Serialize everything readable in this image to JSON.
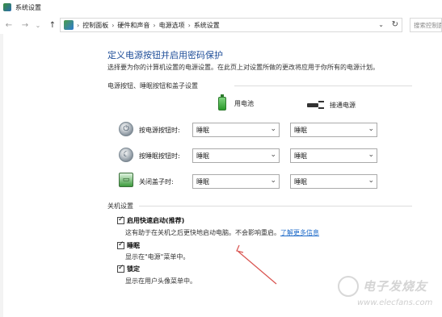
{
  "window": {
    "title": "系统设置"
  },
  "nav": {
    "back": "←",
    "forward": "→",
    "recent": "⌄",
    "up": "↑",
    "breadcrumb": [
      "控制面板",
      "硬件和声音",
      "电源选项",
      "系统设置"
    ],
    "separator": "›",
    "dropdown": "⌄",
    "refresh": "↻"
  },
  "search": {
    "placeholder": "搜索控制面"
  },
  "page": {
    "title": "定义电源按钮并启用密码保护",
    "description": "选择要为你的计算机设置的电源设置。在此页上对设置所做的更改将应用于你所有的电源计划。"
  },
  "buttons_section": {
    "heading": "电源按钮、睡眠按钮和盖子设置",
    "col_battery": "用电池",
    "col_plugged": "接通电源",
    "rows": [
      {
        "label": "按电源按钮时:",
        "battery": "睡眠",
        "plugged": "睡眠",
        "icon": "power-button-icon"
      },
      {
        "label": "按睡眠按钮时:",
        "battery": "睡眠",
        "plugged": "睡眠",
        "icon": "sleep-button-icon"
      },
      {
        "label": "关闭盖子时:",
        "battery": "睡眠",
        "plugged": "睡眠",
        "icon": "lid-icon"
      }
    ],
    "select_arrow": "⌄"
  },
  "shutdown_section": {
    "heading": "关机设置",
    "fast_startup": {
      "label": "启用快速启动(推荐)",
      "checked": true,
      "description": "这有助于在关机之后更快地启动电脑。不会影响重启。",
      "link": "了解更多信息"
    },
    "sleep": {
      "label": "睡眠",
      "checked": true,
      "description": "显示在\"电源\"菜单中。"
    },
    "lock": {
      "label": "锁定",
      "checked": true,
      "description": "显示在用户头像菜单中。"
    }
  },
  "watermark": {
    "brand": "电子发烧友",
    "url": "www.elecfans.com"
  },
  "colors": {
    "title_blue": "#1f4e99",
    "link_blue": "#1f6bc9",
    "annotation_red": "#d9534f"
  }
}
